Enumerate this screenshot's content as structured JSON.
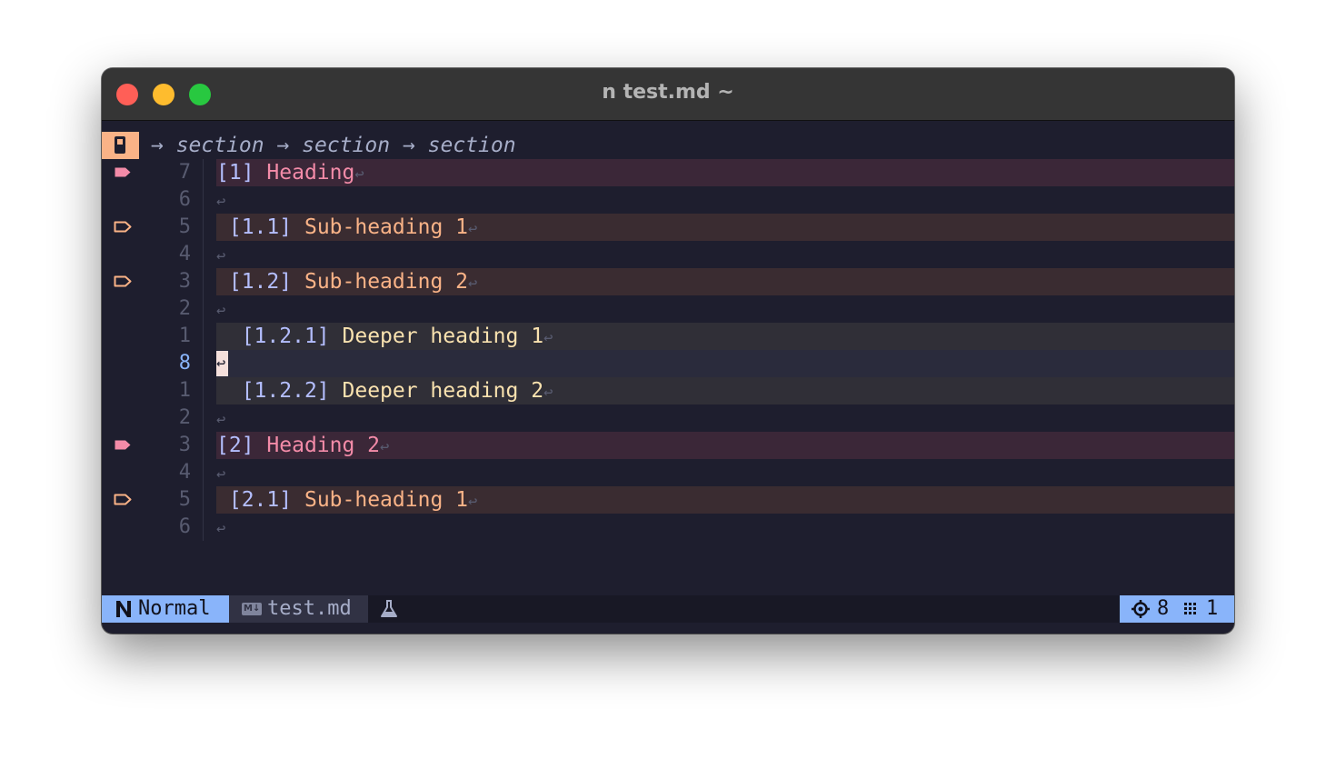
{
  "window": {
    "title": "n test.md ~"
  },
  "winbar": {
    "icon": "device-icon",
    "breadcrumb": "→ section → section → section"
  },
  "lines": [
    {
      "num": "7",
      "sign": "filled",
      "kind": "h1",
      "indent": "",
      "index": "[1]",
      "text": "Heading",
      "nl": "↩"
    },
    {
      "num": "6",
      "sign": "",
      "kind": "blank",
      "nl": "↩"
    },
    {
      "num": "5",
      "sign": "outline",
      "kind": "h2",
      "indent": " ",
      "index": "[1.1]",
      "text": "Sub-heading 1",
      "nl": "↩"
    },
    {
      "num": "4",
      "sign": "",
      "kind": "blank",
      "nl": "↩"
    },
    {
      "num": "3",
      "sign": "outline",
      "kind": "h2",
      "indent": " ",
      "index": "[1.2]",
      "text": "Sub-heading 2",
      "nl": "↩"
    },
    {
      "num": "2",
      "sign": "",
      "kind": "blank",
      "nl": "↩"
    },
    {
      "num": "1",
      "sign": "",
      "kind": "h3",
      "indent": "  ",
      "index": "[1.2.1]",
      "text": "Deeper heading 1",
      "nl": "↩"
    },
    {
      "num": "8",
      "sign": "",
      "kind": "current",
      "nl": "↩"
    },
    {
      "num": "1",
      "sign": "",
      "kind": "h3",
      "indent": "  ",
      "index": "[1.2.2]",
      "text": "Deeper heading 2",
      "nl": "↩"
    },
    {
      "num": "2",
      "sign": "",
      "kind": "blank",
      "nl": "↩"
    },
    {
      "num": "3",
      "sign": "filled",
      "kind": "h1",
      "indent": "",
      "index": "[2]",
      "text": "Heading 2",
      "nl": "↩"
    },
    {
      "num": "4",
      "sign": "",
      "kind": "blank",
      "nl": "↩"
    },
    {
      "num": "5",
      "sign": "outline",
      "kind": "h2",
      "indent": " ",
      "index": "[2.1]",
      "text": "Sub-heading 1",
      "nl": "↩"
    },
    {
      "num": "6",
      "sign": "",
      "kind": "blank",
      "nl": "↩"
    }
  ],
  "statusline": {
    "mode": "Normal",
    "filename": "test.md",
    "line": "8",
    "column": "1"
  },
  "colors": {
    "background": "#1e1e2e",
    "heading1": "#f38ba8",
    "heading2": "#fab387",
    "heading3": "#f9e2af",
    "index": "#b4befe",
    "accent": "#89b4fa"
  }
}
